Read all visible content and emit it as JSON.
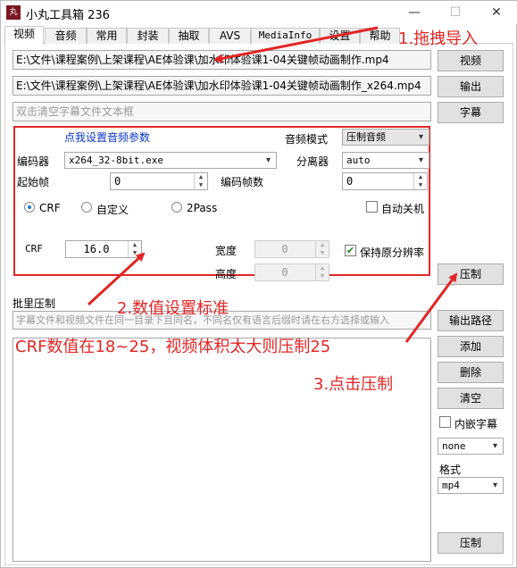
{
  "window": {
    "title": "小丸工具箱 236",
    "icon_text": "丸",
    "min": "—",
    "max": "☐",
    "close": "✕"
  },
  "tabs": [
    "视频",
    "音频",
    "常用",
    "封装",
    "抽取",
    "AVS",
    "MediaInfo",
    "设置",
    "帮助"
  ],
  "files": {
    "video_path": "E:\\文件\\课程案例\\上架课程\\AE体验课\\加水印体验课1-04关键帧动画制作.mp4",
    "output_path": "E:\\文件\\课程案例\\上架课程\\AE体验课\\加水印体验课1-04关键帧动画制作_x264.mp4",
    "subtitle_placeholder": "双击清空字幕文件文本框"
  },
  "buttons": {
    "video": "视频",
    "output": "输出",
    "subtitle": "字幕",
    "compress": "压制",
    "output_path": "输出路径",
    "add": "添加",
    "delete": "删除",
    "clear": "清空",
    "batch_compress": "压制"
  },
  "params": {
    "audio_settings_link": "点我设置音频参数",
    "audio_mode_label": "音频模式",
    "audio_mode_value": "压制音频",
    "encoder_label": "编码器",
    "encoder_value": "x264_32-8bit.exe",
    "demuxer_label": "分离器",
    "demuxer_value": "auto",
    "start_frame_label": "起始帧",
    "start_frame_value": "0",
    "frame_count_label": "编码帧数",
    "frame_count_value": "0",
    "mode_crf": "CRF",
    "mode_custom": "自定义",
    "mode_2pass": "2Pass",
    "auto_shutdown": "自动关机",
    "crf_label": "CRF",
    "crf_value": "16.0",
    "width_label": "宽度",
    "width_value": "0",
    "height_label": "高度",
    "height_value": "0",
    "keep_resolution": "保持原分辨率"
  },
  "batch": {
    "title": "批里压制",
    "hint": "字幕文件和视频文件在同一目录下且同名，不同名仅有语言后缀时请在右方选择或输入",
    "embed_subtitle": "内嵌字幕",
    "subtitle_select": "none",
    "format_label": "格式",
    "format_value": "mp4"
  },
  "annotations": {
    "step1": "1.拖拽导入",
    "step2": "2.数值设置标准",
    "crf_note": "CRF数值在18~25，视频体积太大则压制25",
    "step3": "3.点击压制"
  },
  "colors": {
    "annotation": "#e32525",
    "link": "#0b35c6",
    "app_icon": "#7a1822"
  }
}
